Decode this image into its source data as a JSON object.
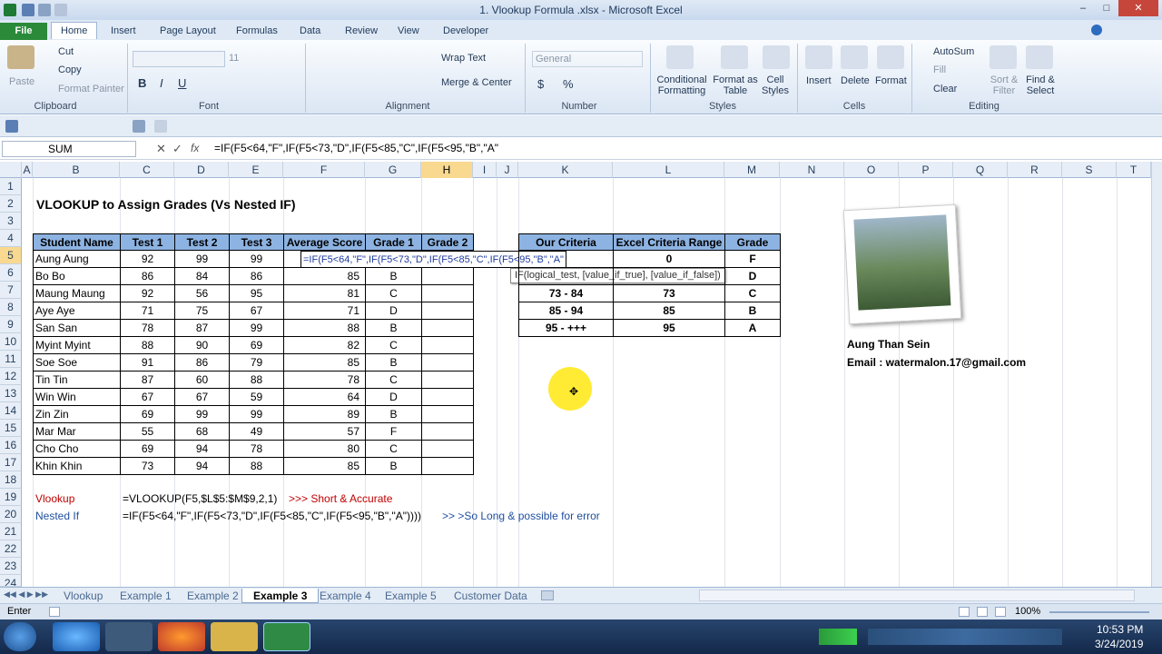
{
  "window": {
    "title": "1. Vlookup Formula .xlsx - Microsoft Excel"
  },
  "ribbon_tabs": [
    "File",
    "Home",
    "Insert",
    "Page Layout",
    "Formulas",
    "Data",
    "Review",
    "View",
    "Developer"
  ],
  "ribbon": {
    "clipboard": {
      "paste": "Paste",
      "cut": "Cut",
      "copy": "Copy",
      "format_painter": "Format Painter",
      "label": "Clipboard"
    },
    "font": {
      "label": "Font",
      "size": "11",
      "bold": "B",
      "italic": "I",
      "underline": "U"
    },
    "alignment": {
      "wrap": "Wrap Text",
      "merge": "Merge & Center",
      "label": "Alignment"
    },
    "number": {
      "format": "General",
      "currency": "$",
      "percent": "%",
      "label": "Number"
    },
    "styles": {
      "cond": "Conditional Formatting",
      "table": "Format as Table",
      "cell": "Cell Styles",
      "label": "Styles"
    },
    "cells": {
      "insert": "Insert",
      "delete": "Delete",
      "format": "Format",
      "label": "Cells"
    },
    "editing": {
      "autosum": "AutoSum",
      "fill": "Fill",
      "clear": "Clear",
      "sort": "Sort & Filter",
      "find": "Find & Select",
      "label": "Editing"
    }
  },
  "formula_bar": {
    "name_box": "SUM",
    "formula": "=IF(F5<64,\"F\",IF(F5<73,\"D\",IF(F5<85,\"C\",IF(F5<95,\"B\",\"A\""
  },
  "columns": [
    "A",
    "B",
    "C",
    "D",
    "E",
    "F",
    "G",
    "H",
    "I",
    "J",
    "K",
    "L",
    "M",
    "N",
    "O",
    "P",
    "Q",
    "R",
    "S",
    "T"
  ],
  "rows": [
    "1",
    "2",
    "3",
    "4",
    "5",
    "6",
    "7",
    "8",
    "9",
    "10",
    "11",
    "12",
    "13",
    "14",
    "15",
    "16",
    "17",
    "18",
    "19",
    "20",
    "21",
    "22",
    "23",
    "24"
  ],
  "sheet": {
    "heading": "VLOOKUP to Assign Grades (Vs Nested IF)",
    "table_headers": [
      "Student Name",
      "Test 1",
      "Test 2",
      "Test 3",
      "Average Score",
      "Grade 1",
      "Grade 2"
    ],
    "students": [
      {
        "name": "Aung Aung",
        "t1": "92",
        "t2": "99",
        "t3": "99",
        "avg": "",
        "g1": ""
      },
      {
        "name": "Bo Bo",
        "t1": "86",
        "t2": "84",
        "t3": "86",
        "avg": "85",
        "g1": "B"
      },
      {
        "name": "Maung Maung",
        "t1": "92",
        "t2": "56",
        "t3": "95",
        "avg": "81",
        "g1": "C"
      },
      {
        "name": "Aye Aye",
        "t1": "71",
        "t2": "75",
        "t3": "67",
        "avg": "71",
        "g1": "D"
      },
      {
        "name": "San San",
        "t1": "78",
        "t2": "87",
        "t3": "99",
        "avg": "88",
        "g1": "B"
      },
      {
        "name": "Myint Myint",
        "t1": "88",
        "t2": "90",
        "t3": "69",
        "avg": "82",
        "g1": "C"
      },
      {
        "name": "Soe Soe",
        "t1": "91",
        "t2": "86",
        "t3": "79",
        "avg": "85",
        "g1": "B"
      },
      {
        "name": "Tin Tin",
        "t1": "87",
        "t2": "60",
        "t3": "88",
        "avg": "78",
        "g1": "C"
      },
      {
        "name": "Win Win",
        "t1": "67",
        "t2": "67",
        "t3": "59",
        "avg": "64",
        "g1": "D"
      },
      {
        "name": "Zin Zin",
        "t1": "69",
        "t2": "99",
        "t3": "99",
        "avg": "89",
        "g1": "B"
      },
      {
        "name": "Mar Mar",
        "t1": "55",
        "t2": "68",
        "t3": "49",
        "avg": "57",
        "g1": "F"
      },
      {
        "name": "Cho Cho",
        "t1": "69",
        "t2": "94",
        "t3": "78",
        "avg": "80",
        "g1": "C"
      },
      {
        "name": "Khin Khin",
        "t1": "73",
        "t2": "94",
        "t3": "88",
        "avg": "85",
        "g1": "B"
      }
    ],
    "editing_formula": "=IF(F5<64,\"F\",IF(F5<73,\"D\",IF(F5<85,\"C\",IF(F5<95,\"B\",\"A\"",
    "tooltip": "IF(logical_test, [value_if_true], [value_if_false])",
    "criteria_headers": [
      "Our Criteria",
      "Excel Criteria Range",
      "Grade"
    ],
    "criteria": [
      {
        "ours": "",
        "range": "0",
        "grade": "F"
      },
      {
        "ours": "",
        "range": "",
        "grade": "D"
      },
      {
        "ours": "73 - 84",
        "range": "73",
        "grade": "C"
      },
      {
        "ours": "85 - 94",
        "range": "85",
        "grade": "B"
      },
      {
        "ours": "95 - +++",
        "range": "95",
        "grade": "A"
      }
    ],
    "author": "Aung Than Sein",
    "email": "Email : watermalon.17@gmail.com",
    "vlookup_label": "Vlookup",
    "vlookup_formula": "=VLOOKUP(F5,$L$5:$M$9,2,1)",
    "vlookup_note": ">>> Short & Accurate",
    "nested_label": "Nested If",
    "nested_formula": "=IF(F5<64,\"F\",IF(F5<73,\"D\",IF(F5<85,\"C\",IF(F5<95,\"B\",\"A\"))))",
    "nested_note": ">> >So Long & possible for error"
  },
  "sheet_tabs": [
    "Vlookup",
    "Example 1",
    "Example 2",
    "Example 3",
    "Example 4",
    "Example 5",
    "Customer Data"
  ],
  "status": {
    "mode": "Enter",
    "zoom": "100%"
  },
  "clock": {
    "time": "10:53 PM",
    "date": "3/24/2019"
  },
  "colors": {
    "table_header": "#8db3e2",
    "selected_header": "#f9d98f",
    "red_label": "#c00000",
    "blue_label": "#1f4e9e"
  }
}
